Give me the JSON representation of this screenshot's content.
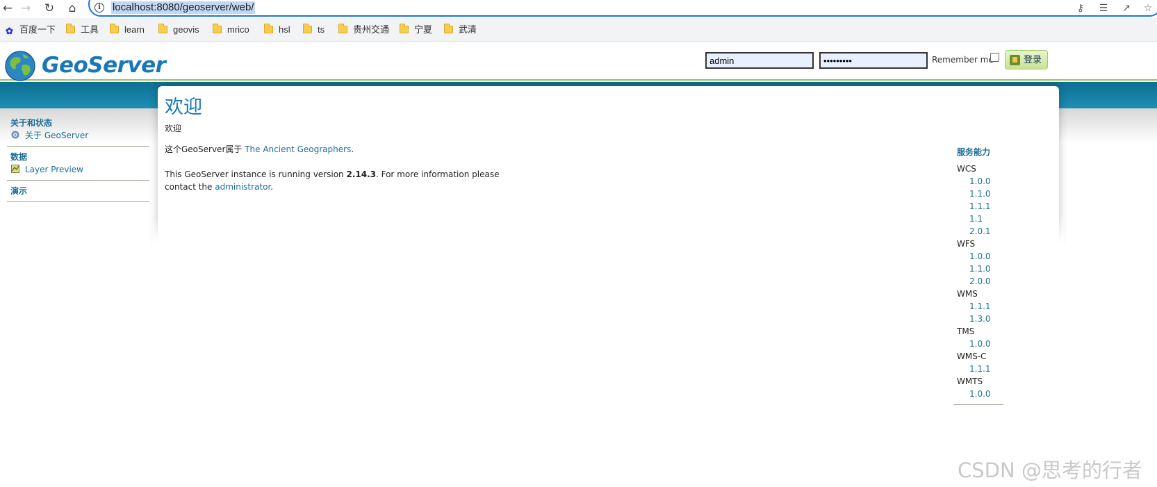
{
  "browser": {
    "url": "localhost:8080/geoserver/web/",
    "bookmarks": [
      "百度一下",
      "工具",
      "learn",
      "geovis",
      "mrico",
      "hsl",
      "ts",
      "贵州交通",
      "宁夏",
      "武清"
    ]
  },
  "header": {
    "logo_text": "GeoServer",
    "username": "admin",
    "password_mask": "•••••••••",
    "remember_label": "Remember me",
    "login_label": "登录"
  },
  "sidebar": {
    "sections": [
      {
        "title": "关于和状态",
        "items": [
          {
            "label": "关于 GeoServer",
            "icon": "help-icon"
          }
        ]
      },
      {
        "title": "数据",
        "items": [
          {
            "label": "Layer Preview",
            "icon": "map-layer-icon"
          }
        ]
      },
      {
        "title": "演示",
        "items": []
      }
    ]
  },
  "main": {
    "title": "欢迎",
    "welcome_text": "欢迎",
    "belongs_prefix": "这个GeoServer属于 ",
    "org_link": "The Ancient Geographers",
    "belongs_suffix": ".",
    "version_prefix": "This GeoServer instance is running version ",
    "version": "2.14.3",
    "version_suffix": ". For more information please contact the ",
    "admin_link": "administrator",
    "admin_suffix": "."
  },
  "capabilities": {
    "title": "服务能力",
    "services": [
      {
        "name": "WCS",
        "versions": [
          "1.0.0",
          "1.1.0",
          "1.1.1",
          "1.1",
          "2.0.1"
        ]
      },
      {
        "name": "WFS",
        "versions": [
          "1.0.0",
          "1.1.0",
          "2.0.0"
        ]
      },
      {
        "name": "WMS",
        "versions": [
          "1.1.1",
          "1.3.0"
        ]
      },
      {
        "name": "TMS",
        "versions": [
          "1.0.0"
        ]
      },
      {
        "name": "WMS-C",
        "versions": [
          "1.1.1"
        ]
      },
      {
        "name": "WMTS",
        "versions": [
          "1.0.0"
        ]
      }
    ]
  },
  "watermark": "CSDN @思考的行者",
  "colors": {
    "accent": "#1a77b6",
    "link": "#1a6e98",
    "band": "#0c6f92",
    "header_rule": "#9dc64f"
  }
}
